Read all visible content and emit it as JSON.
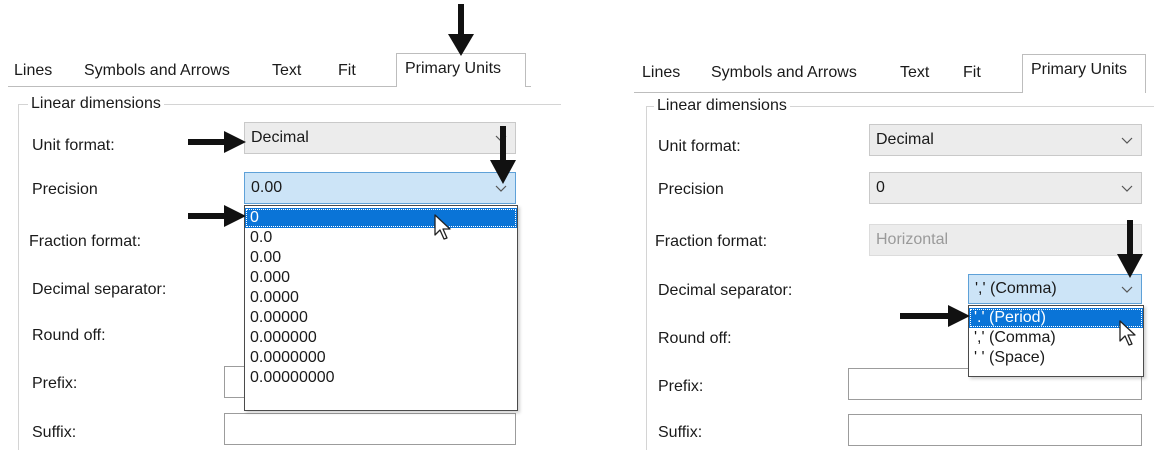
{
  "left": {
    "tabs": [
      "Lines",
      "Symbols and Arrows",
      "Text",
      "Fit",
      "Primary Units"
    ],
    "group_title": "Linear dimensions",
    "fields": {
      "unit_format": {
        "label": "Unit format:",
        "value": "Decimal"
      },
      "precision": {
        "label": "Precision",
        "value": "0.00"
      },
      "fraction_format": {
        "label": "Fraction format:"
      },
      "decimal_separator": {
        "label": "Decimal separator:"
      },
      "round_off": {
        "label": "Round off:"
      },
      "prefix": {
        "label": "Prefix:"
      },
      "suffix": {
        "label": "Suffix:"
      }
    },
    "precision_options": [
      "0",
      "0.0",
      "0.00",
      "0.000",
      "0.0000",
      "0.00000",
      "0.000000",
      "0.0000000",
      "0.00000000"
    ],
    "highlighted_option": "0"
  },
  "right": {
    "tabs": [
      "Lines",
      "Symbols and Arrows",
      "Text",
      "Fit",
      "Primary Units"
    ],
    "group_title": "Linear dimensions",
    "fields": {
      "unit_format": {
        "label": "Unit format:",
        "value": "Decimal"
      },
      "precision": {
        "label": "Precision",
        "value": "0"
      },
      "fraction_format": {
        "label": "Fraction format:",
        "value": "Horizontal"
      },
      "decimal_separator": {
        "label": "Decimal separator:",
        "value": "',' (Comma)"
      },
      "round_off": {
        "label": "Round off:"
      },
      "prefix": {
        "label": "Prefix:"
      },
      "suffix": {
        "label": "Suffix:"
      }
    },
    "separator_options": [
      "'.' (Period)",
      "',' (Comma)",
      "' ' (Space)"
    ],
    "highlighted_option": "'.' (Period)"
  },
  "icons": {
    "chevron": "chevron-down-icon",
    "arrow": "black-arrow-annotation",
    "cursor": "mouse-pointer-icon"
  },
  "colors": {
    "focus_bg": "#cce4f7",
    "selection": "#0a74d7",
    "disabled_text": "#9a9a9a"
  }
}
